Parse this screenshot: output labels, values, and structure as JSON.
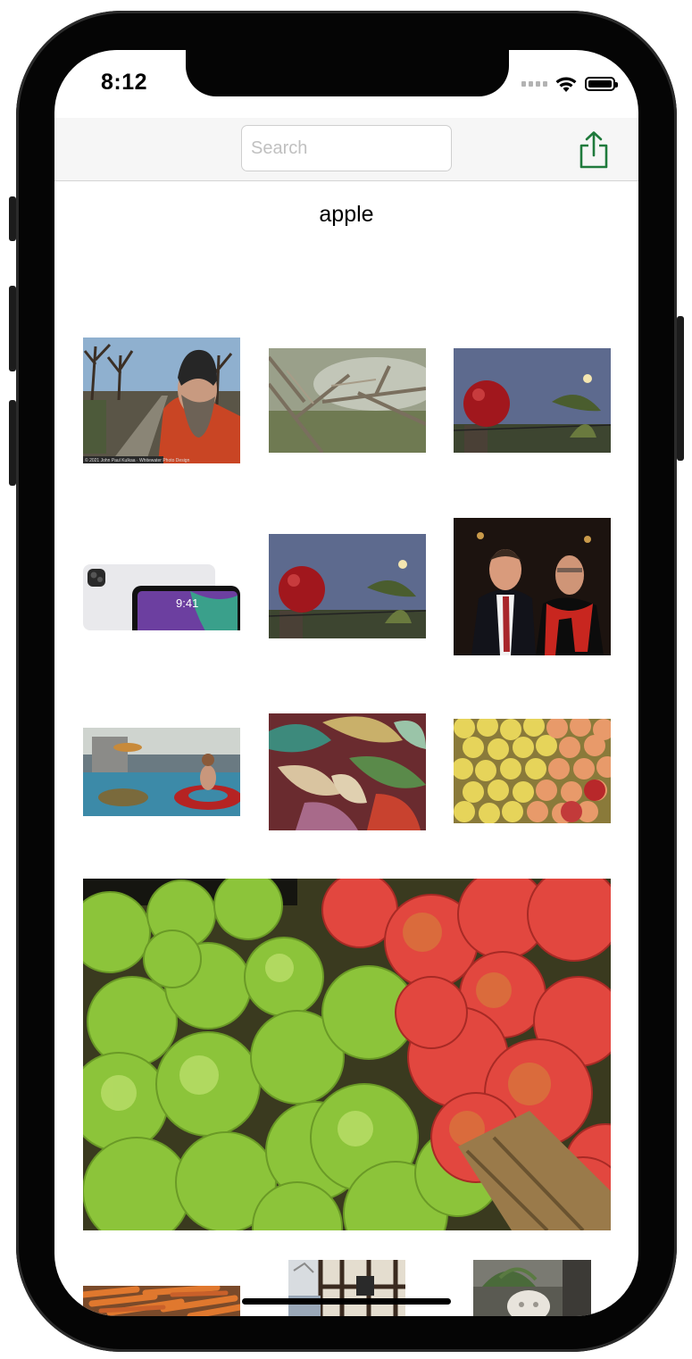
{
  "status_bar": {
    "time": "8:12"
  },
  "navbar": {
    "search_placeholder": "Search",
    "share_icon": "share-icon"
  },
  "query_label": "apple",
  "photos": [
    {
      "name": "photo-bearded-man-road",
      "watermark": "© 2021 John Paul Kulkaa · Whitewater Photo Design"
    },
    {
      "name": "photo-bare-branches"
    },
    {
      "name": "photo-red-apple-on-post"
    },
    {
      "name": "photo-ipad-pro",
      "screen_time": "9:41"
    },
    {
      "name": "photo-red-apple-on-post-2"
    },
    {
      "name": "photo-two-men-red-scarf"
    },
    {
      "name": "photo-pool-float"
    },
    {
      "name": "photo-abstract-leaves"
    },
    {
      "name": "photo-yellow-apples"
    },
    {
      "name": "photo-green-and-red-apples-large"
    },
    {
      "name": "photo-carrots"
    },
    {
      "name": "photo-timber-building"
    },
    {
      "name": "photo-lion-statue"
    }
  ],
  "colors": {
    "accent_green": "#1f7a3c",
    "navbar_bg": "#f6f6f6"
  }
}
